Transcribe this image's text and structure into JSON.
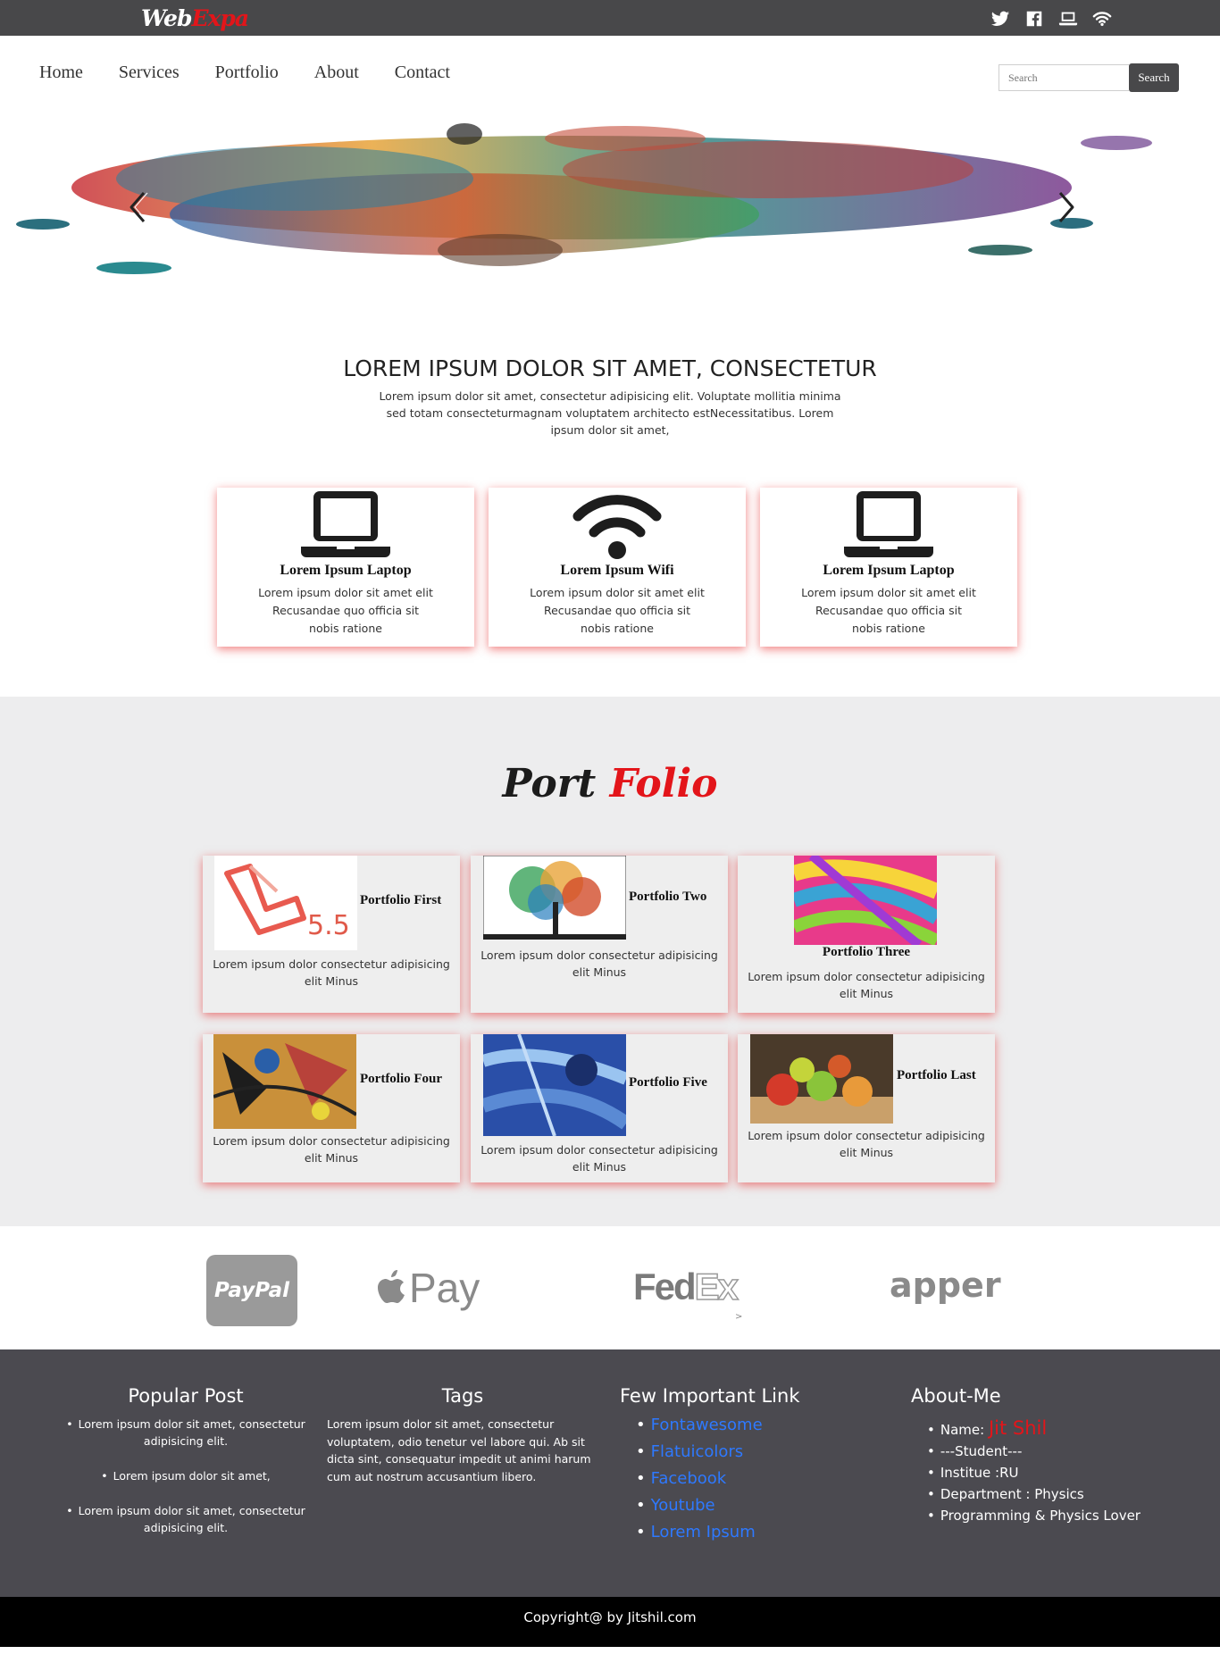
{
  "brand": {
    "name_part1": "Web",
    "name_part2": "Expa"
  },
  "topbar": {
    "icons": [
      "twitter-icon",
      "facebook-icon",
      "laptop-icon",
      "wifi-icon"
    ]
  },
  "nav": {
    "items": [
      "Home",
      "Services",
      "Portfolio",
      "About",
      "Contact"
    ]
  },
  "search": {
    "placeholder": "Search",
    "button_label": "Search"
  },
  "slider": {
    "prev_icon": "chevron-left-icon",
    "next_icon": "chevron-right-icon"
  },
  "intro": {
    "heading": "LOREM IPSUM DOLOR SIT AMET, CONSECTETUR",
    "text": "Lorem ipsum dolor sit amet, consectetur adipisicing elit. Voluptate mollitia minima sed totam consecteturmagnam voluptatem architecto estNecessitatibus. Lorem ipsum dolor sit amet,"
  },
  "features": [
    {
      "icon": "laptop-icon",
      "title": "Lorem Ipsum Laptop",
      "text": "Lorem ipsum dolor sit amet elit Recusandae quo officia sit nobis ratione"
    },
    {
      "icon": "wifi-icon",
      "title": "Lorem Ipsum Wifi",
      "text": "Lorem ipsum dolor sit amet elit Recusandae quo officia sit nobis ratione"
    },
    {
      "icon": "laptop-icon",
      "title": "Lorem Ipsum Laptop",
      "text": "Lorem ipsum dolor sit amet elit Recusandae quo officia sit nobis ratione"
    }
  ],
  "portfolio": {
    "title_part1": "Port",
    "title_part2": "Folio",
    "items": [
      {
        "title": "Portfolio First",
        "text": "Lorem ipsum dolor consectetur adipisicing elit Minus",
        "image": "laravel-logo"
      },
      {
        "title": "Portfolio Two",
        "text": "Lorem ipsum dolor consectetur adipisicing elit Minus",
        "image": "colorful-tree"
      },
      {
        "title": "Portfolio Three",
        "text": "Lorem ipsum dolor consectetur adipisicing elit Minus",
        "image": "color-swirls"
      },
      {
        "title": "Portfolio Four",
        "text": "Lorem ipsum dolor consectetur adipisicing elit Minus",
        "image": "abstract-painting"
      },
      {
        "title": "Portfolio Five",
        "text": "Lorem ipsum dolor consectetur adipisicing elit Minus",
        "image": "blue-abstract"
      },
      {
        "title": "Portfolio Last",
        "text": "Lorem ipsum dolor consectetur adipisicing elit Minus",
        "image": "apples-still-life"
      }
    ]
  },
  "brands": {
    "paypal": "PayPal",
    "applepay": "Pay",
    "fedex_fed": "Fed",
    "fedex_ex": "Ex",
    "fedex_mark": ">",
    "apper": "apper"
  },
  "footer": {
    "popular_post": {
      "title": "Popular Post",
      "items": [
        "Lorem ipsum dolor sit amet, consectetur adipisicing elit.",
        "Lorem ipsum dolor sit amet,",
        "Lorem ipsum dolor sit amet, consectetur adipisicing elit."
      ]
    },
    "tags": {
      "title": "Tags",
      "text": "Lorem ipsum dolor sit amet, consectetur voluptatem, odio tenetur vel labore qui. Ab sit dicta sint, consequatur impedit ut animi harum cum aut nostrum accusantium libero."
    },
    "links": {
      "title": "Few Important Link",
      "items": [
        "Fontawesome",
        "Flatuicolors",
        "Facebook",
        "Youtube",
        "Lorem Ipsum"
      ]
    },
    "about": {
      "title": "About-Me",
      "name_label": "Name:",
      "name_value": "Jit Shil",
      "items": [
        "---Student---",
        "Institue :RU",
        "Department : Physics",
        "Programming & Physics Lover"
      ]
    },
    "copyright": "Copyright@ by Jitshil.com"
  },
  "colors": {
    "topbar": "#48484a",
    "accent_red": "#e3151a",
    "footer": "#4b4a50",
    "link_blue": "#2e79ff"
  }
}
